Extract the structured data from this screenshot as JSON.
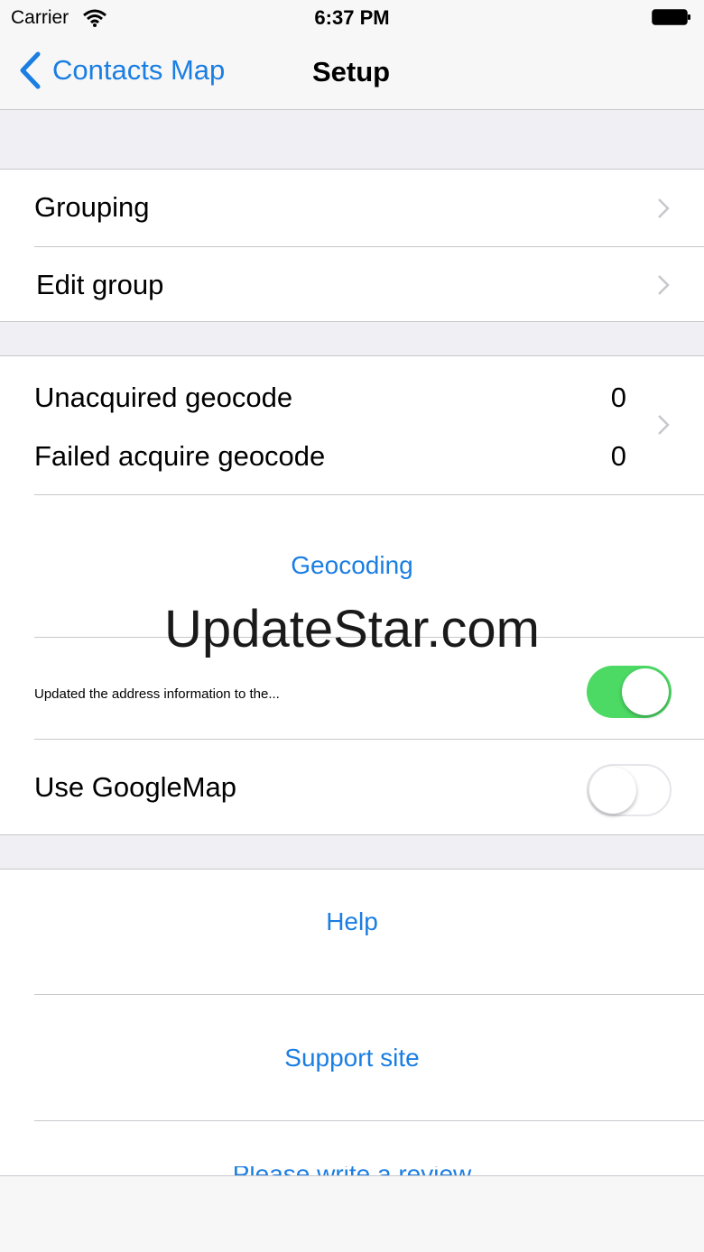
{
  "status_bar": {
    "carrier": "Carrier",
    "time": "6:37 PM"
  },
  "nav": {
    "back_label": "Contacts Map",
    "title": "Setup"
  },
  "colors": {
    "tint": "#1b7ee2",
    "switch_on": "#4cd964",
    "background": "#efeff4"
  },
  "group1": {
    "grouping_label": "Grouping",
    "edit_group_label": "Edit group"
  },
  "group2": {
    "unacquired_label": "Unacquired geocode",
    "unacquired_value": "0",
    "failed_label": "Failed acquire geocode",
    "failed_value": "0",
    "geocoding_button": "Geocoding",
    "auto_update_label": "Updated the address information to the...",
    "auto_update_on": true,
    "googlemap_label": "Use GoogleMap",
    "googlemap_on": false
  },
  "group3": {
    "help_label": "Help",
    "support_label": "Support site",
    "partial_label": "Please write a review"
  },
  "watermark": "UpdateStar.com"
}
